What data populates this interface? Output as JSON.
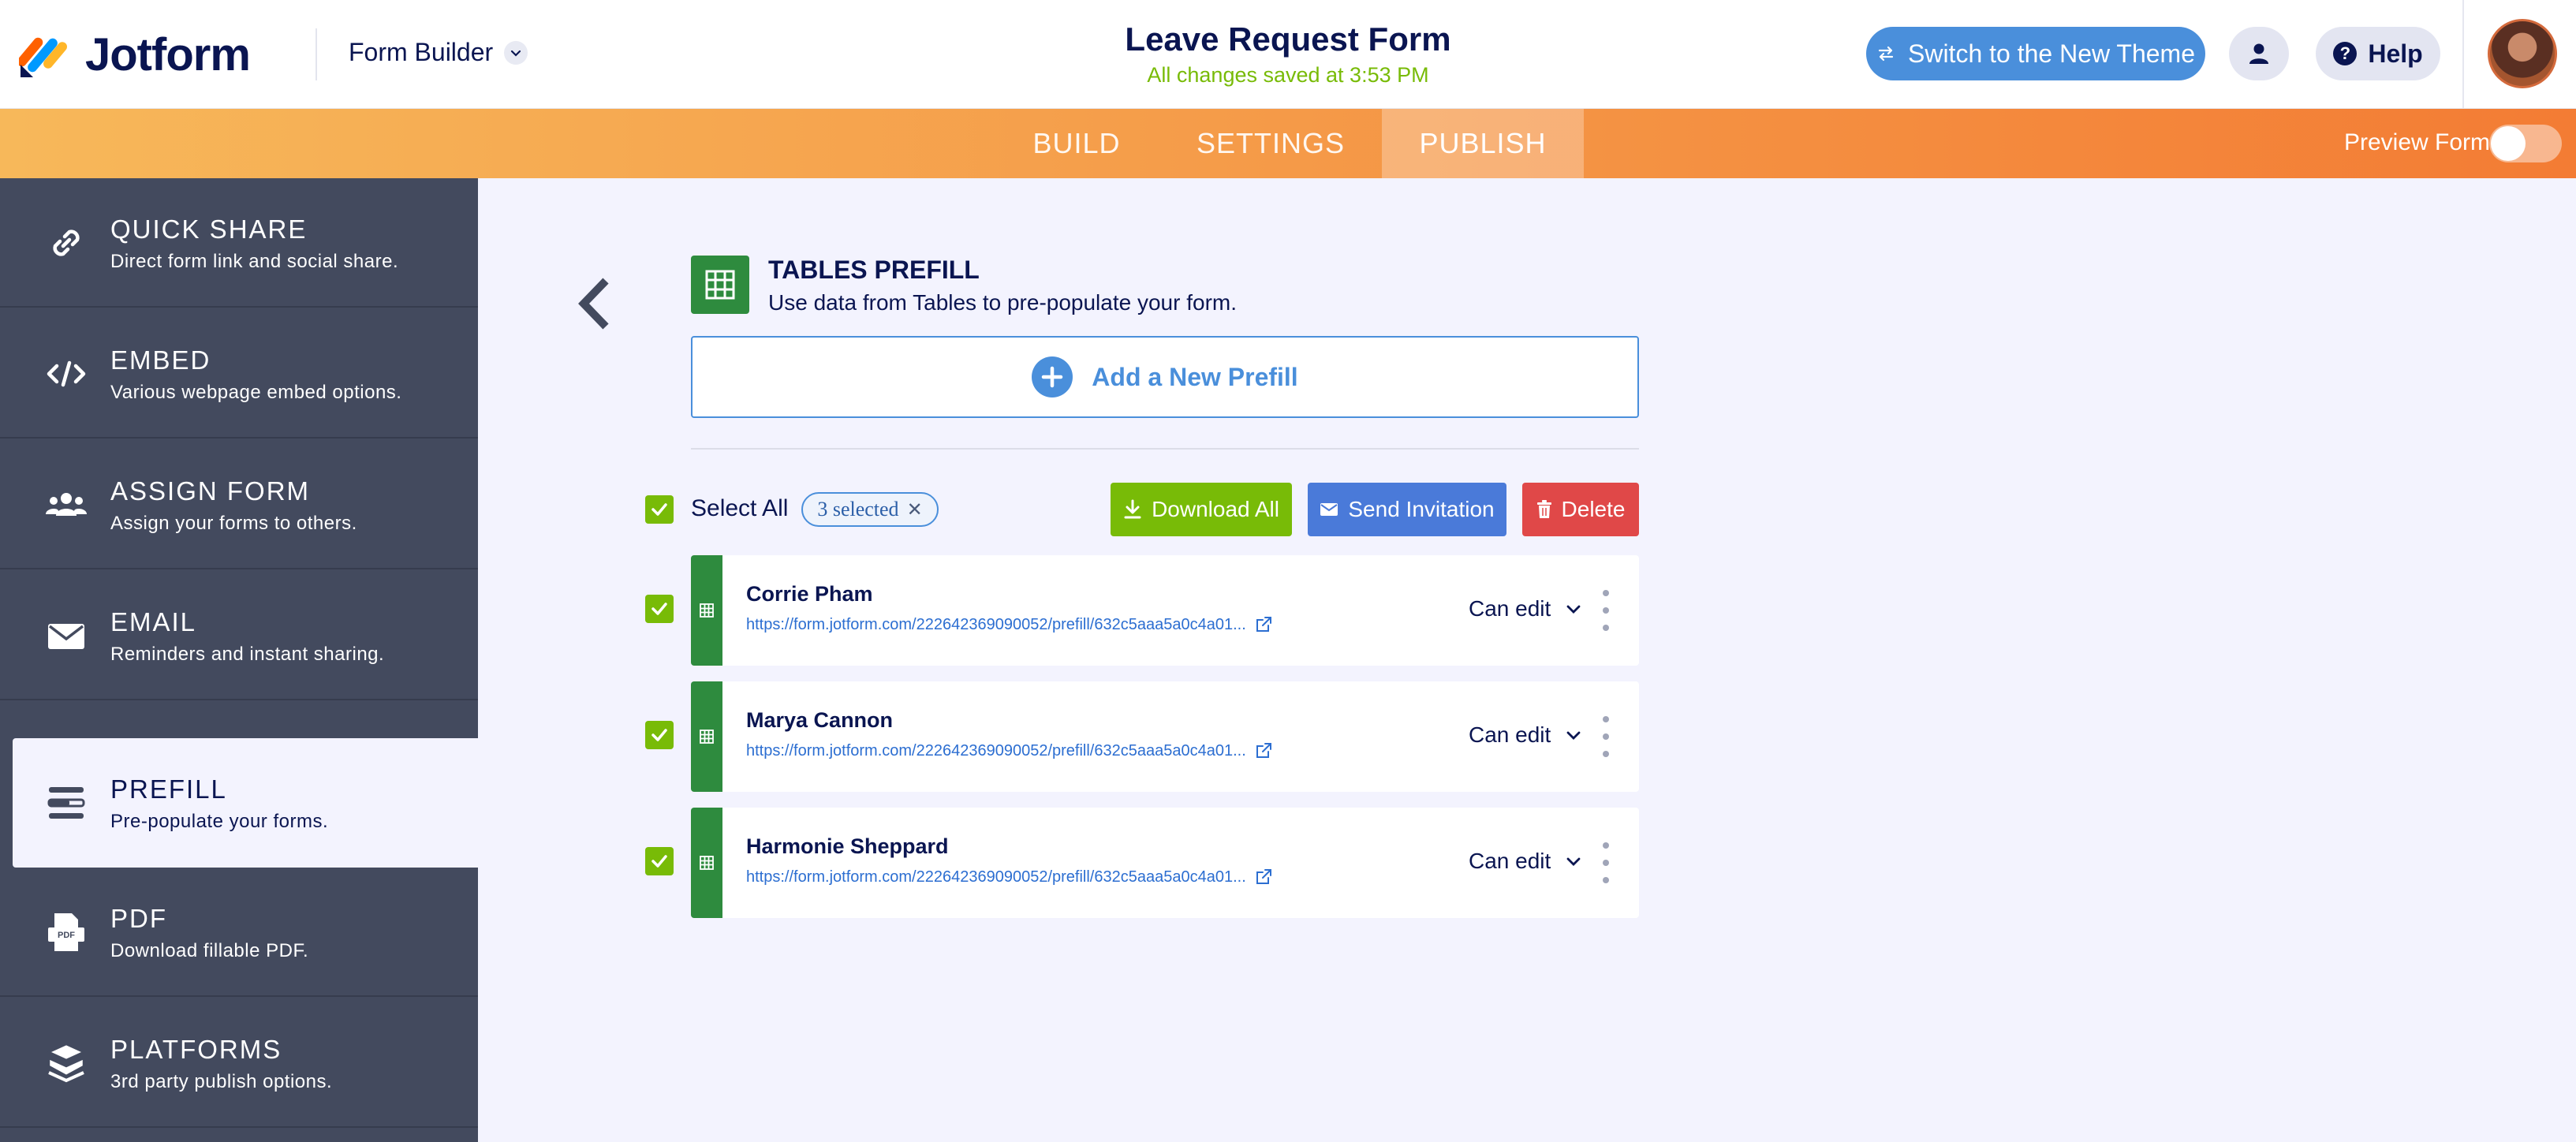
{
  "header": {
    "logo_text": "Jotform",
    "builder_label": "Form Builder",
    "form_title": "Leave Request Form",
    "saved_status": "All changes saved at 3:53 PM",
    "theme_button": "Switch to the New Theme",
    "help_button": "Help"
  },
  "nav": {
    "tabs": [
      {
        "label": "BUILD"
      },
      {
        "label": "SETTINGS"
      },
      {
        "label": "PUBLISH",
        "active": true
      }
    ],
    "preview_label": "Preview Form",
    "preview_on": false
  },
  "sidebar": {
    "items": [
      {
        "title": "QUICK SHARE",
        "desc": "Direct form link and social share.",
        "icon": "link-icon"
      },
      {
        "title": "EMBED",
        "desc": "Various webpage embed options.",
        "icon": "code-icon"
      },
      {
        "title": "ASSIGN FORM",
        "desc": "Assign your forms to others.",
        "icon": "users-icon"
      },
      {
        "title": "EMAIL",
        "desc": "Reminders and instant sharing.",
        "icon": "envelope-icon"
      },
      {
        "title": "PREFILL",
        "desc": "Pre-populate your forms.",
        "icon": "prefill-icon",
        "active": true
      },
      {
        "title": "PDF",
        "desc": "Download fillable PDF.",
        "icon": "pdf-icon"
      },
      {
        "title": "PLATFORMS",
        "desc": "3rd party publish options.",
        "icon": "layers-icon"
      }
    ]
  },
  "main": {
    "section_title": "TABLES PREFILL",
    "section_subtitle": "Use data from Tables to pre-populate your form.",
    "add_prefill_label": "Add a New Prefill",
    "select_all_label": "Select All",
    "selected_count_label": "3 selected",
    "download_all_label": "Download All",
    "send_invitation_label": "Send Invitation",
    "delete_label": "Delete",
    "prefills": [
      {
        "name": "Corrie Pham",
        "url": "https://form.jotform.com/222642369090052/prefill/632c5aaa5a0c4a01...",
        "permission": "Can edit",
        "checked": true
      },
      {
        "name": "Marya Cannon",
        "url": "https://form.jotform.com/222642369090052/prefill/632c5aaa5a0c4a01...",
        "permission": "Can edit",
        "checked": true
      },
      {
        "name": "Harmonie Sheppard",
        "url": "https://form.jotform.com/222642369090052/prefill/632c5aaa5a0c4a01...",
        "permission": "Can edit",
        "checked": true
      }
    ]
  },
  "colors": {
    "accent_blue": "#4a8fdb",
    "success_green": "#78bb07",
    "danger_red": "#e04848",
    "tables_green": "#2e8b3e",
    "sidebar_bg": "#434a5e"
  }
}
